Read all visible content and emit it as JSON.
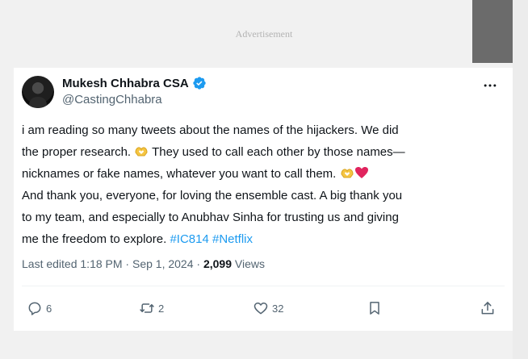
{
  "page": {
    "advertisement_label": "Advertisement"
  },
  "tweet": {
    "author": {
      "name": "Mukesh Chhabra CSA",
      "handle": "@CastingChhabra",
      "verified": true
    },
    "text": {
      "line1": "i am reading so many tweets about the names of the hijackers. We did",
      "line2_a": "the proper research. ",
      "line2_b": " They used to call each other by those names—",
      "line3_a": "nicknames or fake names, whatever you want to call them. ",
      "line4": "And thank you, everyone, for loving the ensemble cast. A big thank you",
      "line5": "to my team, and especially to Anubhav Sinha for trusting us and giving",
      "line6_a": "me the freedom to explore. ",
      "hashtag1": "#IC814",
      "hashtag2": "#Netflix"
    },
    "meta": {
      "edited_prefix": "Last edited ",
      "time": "1:18 PM",
      "separator": " · ",
      "date": "Sep 1, 2024",
      "views_count": "2,099",
      "views_label": " Views"
    },
    "actions": {
      "replies": "6",
      "reposts": "2",
      "likes": "32"
    },
    "icons": {
      "more": "more-horizontal-icon",
      "verified": "verified-badge-icon",
      "reply": "reply-icon",
      "repost": "repost-icon",
      "like": "like-icon",
      "bookmark": "bookmark-icon",
      "share": "share-icon",
      "emoji_hands": "heart-hands-emoji",
      "emoji_heart": "red-heart-emoji"
    },
    "colors": {
      "verified": "#1d9bf0",
      "hashtag": "#1d9bf0",
      "heart": "#e0245e",
      "hands": "#f5c542"
    }
  }
}
